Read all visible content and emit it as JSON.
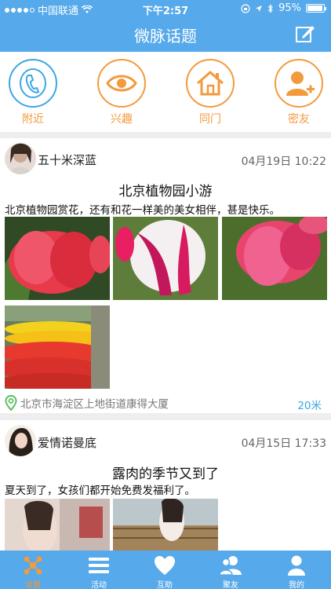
{
  "status_bar": {
    "carrier": "中国联通",
    "time": "下午2:57",
    "battery": "95%",
    "battery_level": 0.95
  },
  "nav": {
    "title": "微脉话题",
    "compose_icon": "compose-icon"
  },
  "categories": [
    {
      "label": "附近",
      "icon": "phone-icon",
      "color": "#3aa7e2"
    },
    {
      "label": "兴趣",
      "icon": "eye-icon",
      "color": "#f39a3c"
    },
    {
      "label": "同门",
      "icon": "home-icon",
      "color": "#f39a3c"
    },
    {
      "label": "密友",
      "icon": "add-friend-icon",
      "color": "#f39a3c"
    }
  ],
  "posts": [
    {
      "user": "五十米深蓝",
      "time": "04月19日 10:22",
      "title": "北京植物园小游",
      "body": "北京植物园赏花，还有和花一样美的美女相伴，甚是快乐。",
      "location": "北京市海淀区上地街道康得大厦",
      "distance": "20米"
    },
    {
      "user": "爱情诺曼底",
      "time": "04月15日 17:33",
      "title": "露肉的季节又到了",
      "body": "夏天到了，女孩们都开始免费发福利了。"
    }
  ],
  "tabs": [
    {
      "label": "话题",
      "icon": "topics-icon",
      "active": true
    },
    {
      "label": "活动",
      "icon": "menu-icon",
      "active": false
    },
    {
      "label": "互助",
      "icon": "heart-icon",
      "active": false
    },
    {
      "label": "聚友",
      "icon": "group-icon",
      "active": false
    },
    {
      "label": "我的",
      "icon": "person-icon",
      "active": false
    }
  ],
  "colors": {
    "brand_blue": "#56a9ea",
    "accent_orange": "#f39a3c",
    "link_blue": "#3aa7e2"
  }
}
